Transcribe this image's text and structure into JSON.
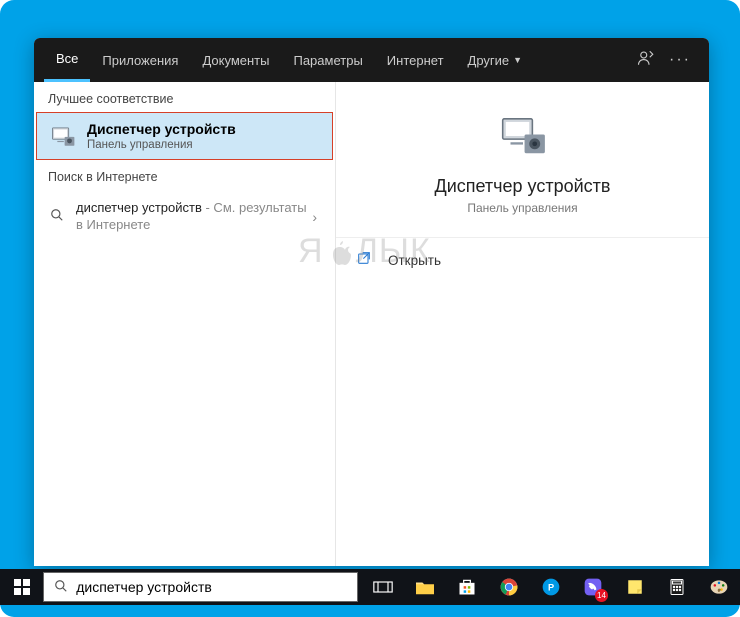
{
  "tabs": {
    "all": "Все",
    "apps": "Приложения",
    "docs": "Документы",
    "settings": "Параметры",
    "web": "Интернет",
    "more": "Другие"
  },
  "sections": {
    "best_match": "Лучшее соответствие",
    "web_search": "Поиск в Интернете"
  },
  "best": {
    "title": "Диспетчер устройств",
    "subtitle": "Панель управления"
  },
  "webresult": {
    "query": "диспетчер устройств",
    "suffix": " - См. результаты в Интернете"
  },
  "detail": {
    "title": "Диспетчер устройств",
    "subtitle": "Панель управления",
    "open": "Открыть"
  },
  "watermark": {
    "left": "Я",
    "right": "ЛЫК"
  },
  "taskbar": {
    "search_value": "диспетчер устройств",
    "badge_viber": "14"
  }
}
